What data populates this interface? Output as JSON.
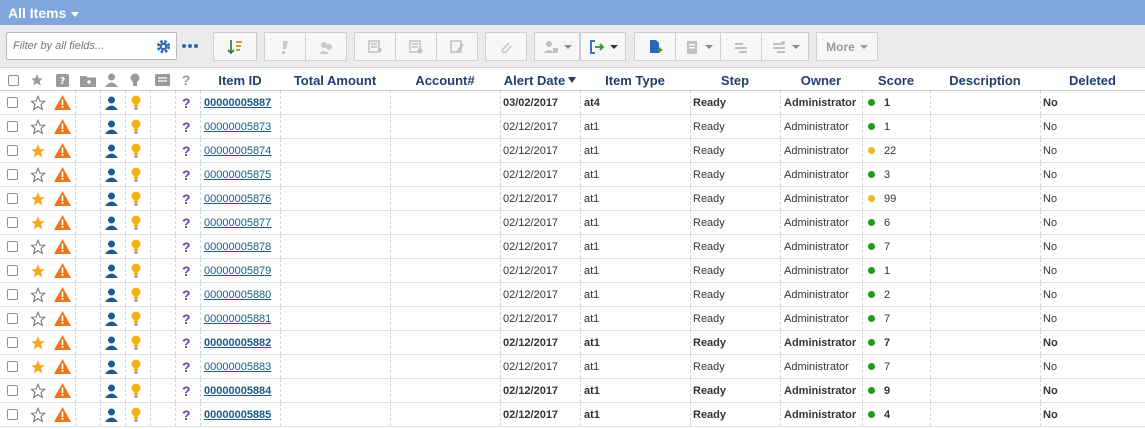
{
  "header": {
    "title": "All Items"
  },
  "filter": {
    "placeholder": "Filter by all fields..."
  },
  "toolbar": {
    "more_label": "More"
  },
  "columns": {
    "item_id": "Item ID",
    "total_amount": "Total Amount",
    "account": "Account#",
    "alert_date": "Alert Date",
    "item_type": "Item Type",
    "step": "Step",
    "owner": "Owner",
    "score": "Score",
    "description": "Description",
    "deleted": "Deleted"
  },
  "colors": {
    "green": "#1f9a1f",
    "yellow": "#f2b51c",
    "star": "#f7a823",
    "warning": "#f07320",
    "user": "#1d5b8c",
    "bulb": "#f7b51c",
    "header": "#7ea6da"
  },
  "rows": [
    {
      "starred": false,
      "item_id": "00000005887",
      "alert_date": "03/02/2017",
      "item_type": "at4",
      "step": "Ready",
      "owner": "Administrator",
      "score_color": "green",
      "score": "1",
      "deleted": "No",
      "bold": true
    },
    {
      "starred": false,
      "item_id": "00000005873",
      "alert_date": "02/12/2017",
      "item_type": "at1",
      "step": "Ready",
      "owner": "Administrator",
      "score_color": "green",
      "score": "1",
      "deleted": "No",
      "bold": false
    },
    {
      "starred": true,
      "item_id": "00000005874",
      "alert_date": "02/12/2017",
      "item_type": "at1",
      "step": "Ready",
      "owner": "Administrator",
      "score_color": "yellow",
      "score": "22",
      "deleted": "No",
      "bold": false
    },
    {
      "starred": false,
      "item_id": "00000005875",
      "alert_date": "02/12/2017",
      "item_type": "at1",
      "step": "Ready",
      "owner": "Administrator",
      "score_color": "green",
      "score": "3",
      "deleted": "No",
      "bold": false
    },
    {
      "starred": true,
      "item_id": "00000005876",
      "alert_date": "02/12/2017",
      "item_type": "at1",
      "step": "Ready",
      "owner": "Administrator",
      "score_color": "yellow",
      "score": "99",
      "deleted": "No",
      "bold": false
    },
    {
      "starred": true,
      "item_id": "00000005877",
      "alert_date": "02/12/2017",
      "item_type": "at1",
      "step": "Ready",
      "owner": "Administrator",
      "score_color": "green",
      "score": "6",
      "deleted": "No",
      "bold": false
    },
    {
      "starred": false,
      "item_id": "00000005878",
      "alert_date": "02/12/2017",
      "item_type": "at1",
      "step": "Ready",
      "owner": "Administrator",
      "score_color": "green",
      "score": "7",
      "deleted": "No",
      "bold": false
    },
    {
      "starred": true,
      "item_id": "00000005879",
      "alert_date": "02/12/2017",
      "item_type": "at1",
      "step": "Ready",
      "owner": "Administrator",
      "score_color": "green",
      "score": "1",
      "deleted": "No",
      "bold": false
    },
    {
      "starred": false,
      "item_id": "00000005880",
      "alert_date": "02/12/2017",
      "item_type": "at1",
      "step": "Ready",
      "owner": "Administrator",
      "score_color": "green",
      "score": "2",
      "deleted": "No",
      "bold": false
    },
    {
      "starred": false,
      "item_id": "00000005881",
      "alert_date": "02/12/2017",
      "item_type": "at1",
      "step": "Ready",
      "owner": "Administrator",
      "score_color": "green",
      "score": "7",
      "deleted": "No",
      "bold": false
    },
    {
      "starred": true,
      "item_id": "00000005882",
      "alert_date": "02/12/2017",
      "item_type": "at1",
      "step": "Ready",
      "owner": "Administrator",
      "score_color": "green",
      "score": "7",
      "deleted": "No",
      "bold": true
    },
    {
      "starred": true,
      "item_id": "00000005883",
      "alert_date": "02/12/2017",
      "item_type": "at1",
      "step": "Ready",
      "owner": "Administrator",
      "score_color": "green",
      "score": "7",
      "deleted": "No",
      "bold": false
    },
    {
      "starred": false,
      "item_id": "00000005884",
      "alert_date": "02/12/2017",
      "item_type": "at1",
      "step": "Ready",
      "owner": "Administrator",
      "score_color": "green",
      "score": "9",
      "deleted": "No",
      "bold": true
    },
    {
      "starred": false,
      "item_id": "00000005885",
      "alert_date": "02/12/2017",
      "item_type": "at1",
      "step": "Ready",
      "owner": "Administrator",
      "score_color": "green",
      "score": "4",
      "deleted": "No",
      "bold": true
    }
  ]
}
